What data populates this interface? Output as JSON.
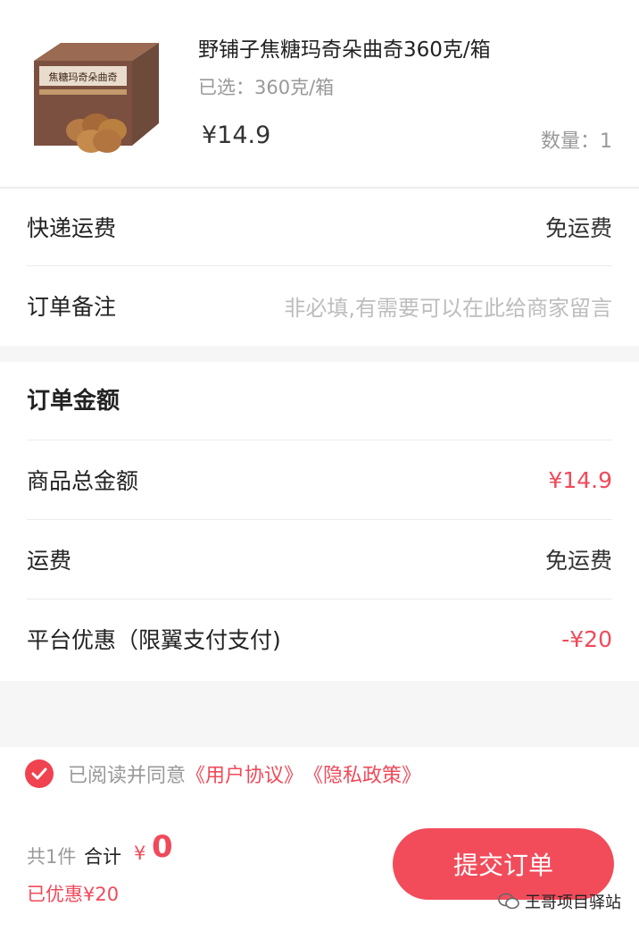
{
  "product": {
    "title": "野铺子焦糖玛奇朵曲奇360克/箱",
    "spec": "已选：360克/箱",
    "price": "¥14.9",
    "quantity": "数量：1",
    "box_brand_text": "焦糖玛奇朵曲奇"
  },
  "shipping": {
    "label": "快递运费",
    "value": "免运费"
  },
  "remark": {
    "label": "订单备注",
    "placeholder": "非必填,有需要可以在此给商家留言"
  },
  "order_amount": {
    "title": "订单金额",
    "rows": [
      {
        "label": "商品总金额",
        "value": "¥14.9"
      },
      {
        "label": "运费",
        "value": "免运费"
      },
      {
        "label": "平台优惠（限翼支付支付)",
        "value": "-¥20"
      }
    ]
  },
  "agreement": {
    "text": "已阅读并同意",
    "user_agreement": "《用户协议》",
    "privacy_policy": "《隐私政策》",
    "checked": true
  },
  "footer": {
    "count": "共1件",
    "total_label": "合计",
    "total_symbol": "¥",
    "total_value": "0",
    "saved": "已优惠¥20",
    "submit_label": "提交订单"
  },
  "watermark": {
    "text": "王哥项目驿站"
  },
  "colors": {
    "accent": "#f04a5a",
    "button": "#f24c5b",
    "gap": "#f6f6f6"
  }
}
